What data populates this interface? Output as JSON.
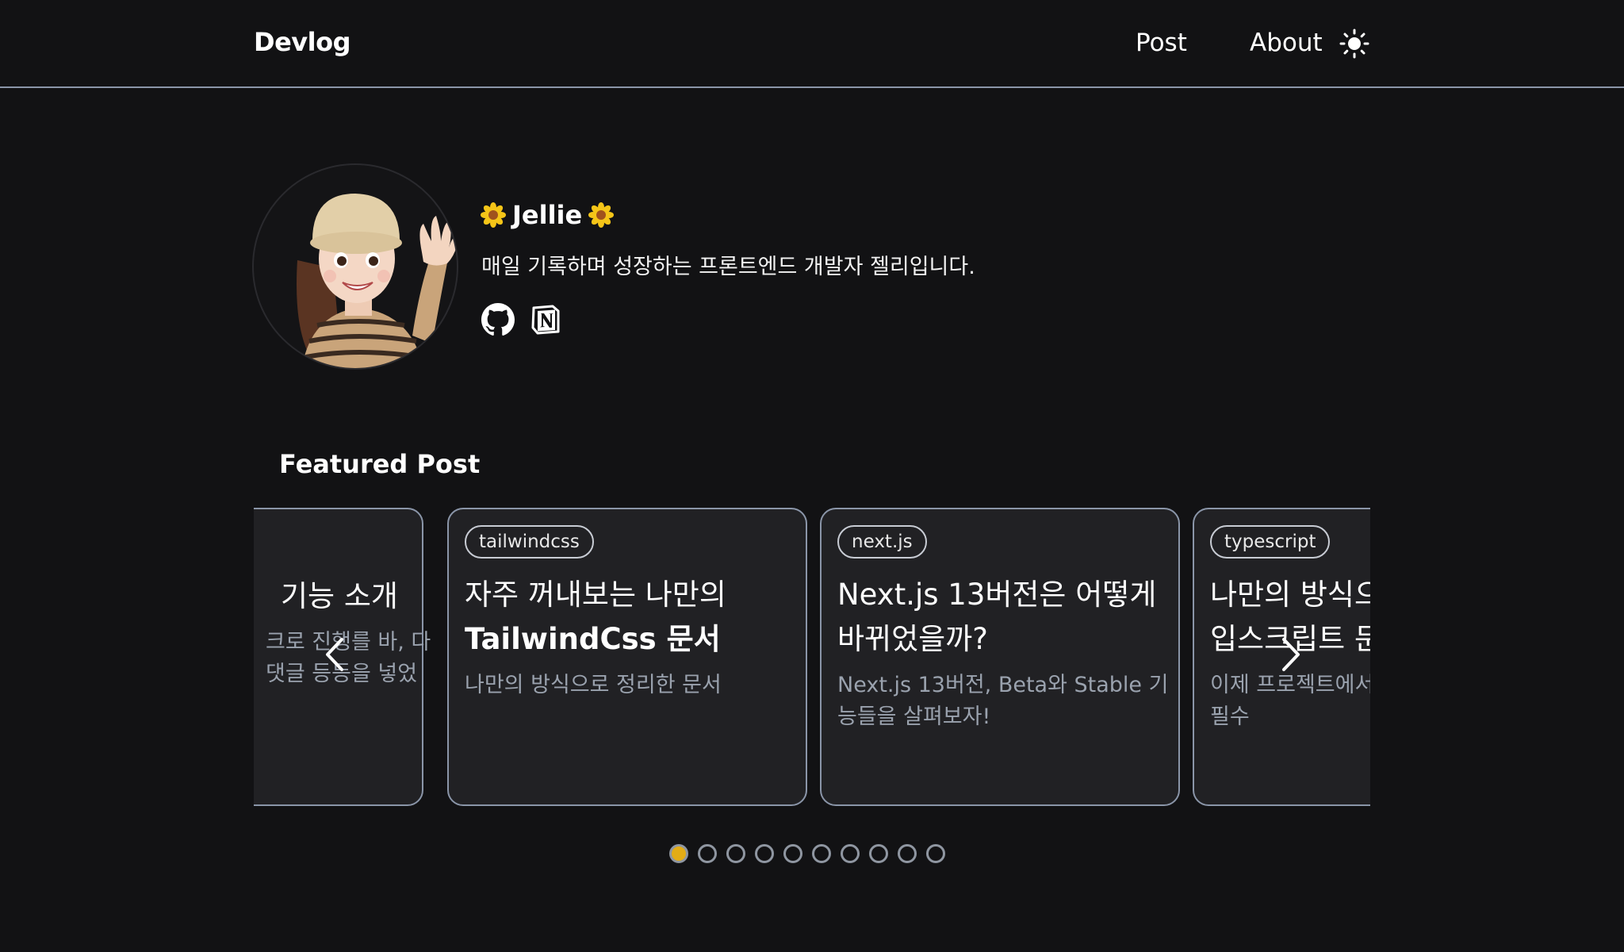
{
  "header": {
    "logo": "Devlog",
    "nav": [
      "Post",
      "About"
    ],
    "theme_icon": "sun-icon"
  },
  "profile": {
    "name": "Jellie",
    "name_decoration_icon": "sunflower-icon",
    "description": "매일 기록하며 성장하는 프론트엔드 개발자 젤리입니다.",
    "social_icons": [
      "github-icon",
      "notion-icon"
    ]
  },
  "featured": {
    "title": "Featured Post",
    "cards": [
      {
        "tag": "",
        "title_lines": [
          "기능 소개"
        ],
        "desc_lines": [
          "크로 진행를 바, 다",
          "댓글 등등을 넣었"
        ]
      },
      {
        "tag": "tailwindcss",
        "title_lines": [
          "자주 꺼내보는 나만의",
          "TailwindCss 문서"
        ],
        "desc_lines": [
          "나만의 방식으로 정리한 문서"
        ]
      },
      {
        "tag": "next.js",
        "title_lines": [
          "Next.js 13버전은 어떻게",
          "바뀌었을까?"
        ],
        "desc_lines": [
          "Next.js 13버전, Beta와 Stable 기",
          "능들을 살펴보자!"
        ]
      },
      {
        "tag": "typescript",
        "title_lines": [
          "나만의 방식으",
          "입스크립트 문"
        ],
        "desc_lines": [
          "이제 프로젝트에서",
          "필수"
        ]
      }
    ],
    "active_slide": 1,
    "total_slides": 10
  },
  "colors": {
    "background": "#121214",
    "card": "#212124",
    "border": "#8a95a8",
    "active_dot": "#e3ac16"
  }
}
